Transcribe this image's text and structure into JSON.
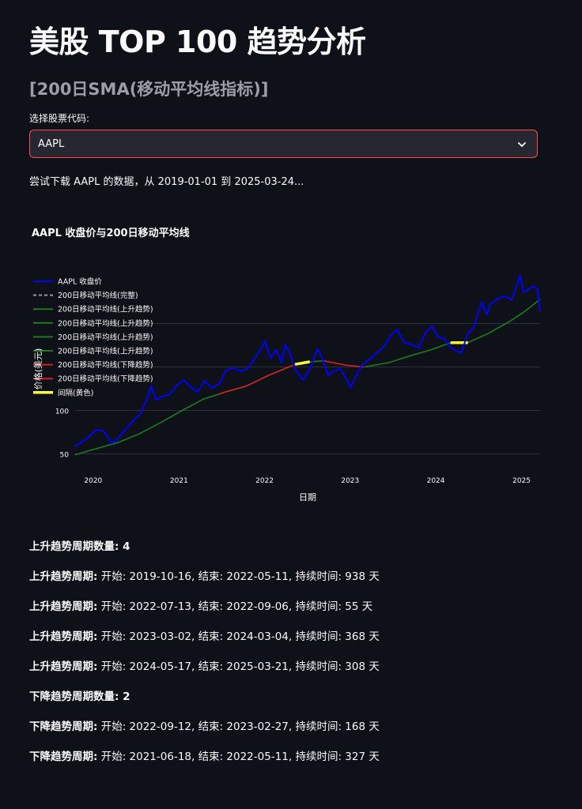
{
  "title": "美股 TOP 100 趋势分析",
  "subtitle": "[200日SMA(移动平均线指标)]",
  "selector": {
    "label": "选择股票代码:",
    "value": "AAPL"
  },
  "info": "尝试下载 AAPL 的数据，从 2019-01-01 到 2025-03-24...",
  "colors": {
    "accent": "#ff4b4b",
    "price": "#0000ff",
    "sma_up": "#1f7a1f",
    "sma_down": "#d62020",
    "gap": "#ffff33"
  },
  "chart_data": {
    "type": "line",
    "title": "AAPL 收盘价与200日移动平均线",
    "xlabel": "日期",
    "ylabel": "价格(美元)",
    "x_ticks": [
      "2020",
      "2021",
      "2022",
      "2023",
      "2024",
      "2025"
    ],
    "y_ticks": [
      "50",
      "100"
    ],
    "ylim": [
      45,
      255
    ],
    "grid": true,
    "legend_position": "top-left",
    "legend": [
      "AAPL 收盘价",
      "200日移动平均线(完整)",
      "200日移动平均线(上升趋势)",
      "200日移动平均线(上升趋势)",
      "200日移动平均线(上升趋势)",
      "200日移动平均线(上升趋势)",
      "200日移动平均线(下降趋势)",
      "200日移动平均线(下降趋势)",
      "间隔(黄色)"
    ],
    "series": [
      {
        "name": "AAPL 收盘价",
        "x": [
          "2019-10-16",
          "2019-11-15",
          "2019-12-15",
          "2020-01-15",
          "2020-02-15",
          "2020-03-20",
          "2020-04-20",
          "2020-05-20",
          "2020-06-20",
          "2020-07-20",
          "2020-08-20",
          "2020-09-05",
          "2020-09-25",
          "2020-10-20",
          "2020-11-20",
          "2020-12-20",
          "2021-01-20",
          "2021-02-20",
          "2021-03-20",
          "2021-04-20",
          "2021-05-20",
          "2021-06-20",
          "2021-07-20",
          "2021-08-20",
          "2021-09-20",
          "2021-10-20",
          "2021-11-20",
          "2021-12-20",
          "2022-01-03",
          "2022-01-27",
          "2022-02-20",
          "2022-03-15",
          "2022-03-30",
          "2022-04-20",
          "2022-05-11",
          "2022-06-15",
          "2022-07-13",
          "2022-08-15",
          "2022-09-06",
          "2022-09-30",
          "2022-10-20",
          "2022-11-20",
          "2022-12-20",
          "2023-01-03",
          "2023-01-20",
          "2023-02-20",
          "2023-03-20",
          "2023-04-20",
          "2023-05-20",
          "2023-06-20",
          "2023-07-20",
          "2023-08-20",
          "2023-09-20",
          "2023-10-20",
          "2023-11-20",
          "2023-12-15",
          "2024-01-10",
          "2024-02-10",
          "2024-03-04",
          "2024-04-19",
          "2024-05-17",
          "2024-06-10",
          "2024-07-15",
          "2024-08-05",
          "2024-08-20",
          "2024-09-20",
          "2024-10-20",
          "2024-11-20",
          "2024-12-26",
          "2025-01-10",
          "2025-02-20",
          "2025-03-10",
          "2025-03-21"
        ],
        "values": [
          59,
          64,
          70,
          78,
          76,
          62,
          69,
          79,
          88,
          96,
          115,
          128,
          112,
          116,
          118,
          128,
          135,
          127,
          121,
          134,
          126,
          130,
          146,
          149,
          145,
          148,
          160,
          172,
          180,
          160,
          170,
          155,
          176,
          165,
          147,
          135,
          148,
          171,
          159,
          140,
          145,
          148,
          134,
          126,
          137,
          152,
          158,
          165,
          172,
          185,
          193,
          178,
          176,
          172,
          190,
          197,
          185,
          182,
          172,
          166,
          189,
          195,
          225,
          210,
          222,
          228,
          232,
          227,
          255,
          236,
          243,
          240,
          214
        ]
      },
      {
        "name": "200日移动平均线",
        "x": [
          "2019-10-16",
          "2020-01-15",
          "2020-04-15",
          "2020-07-15",
          "2020-10-15",
          "2021-01-15",
          "2021-04-15",
          "2021-07-15",
          "2021-10-15",
          "2022-01-15",
          "2022-05-11",
          "2022-07-13",
          "2022-09-06",
          "2022-09-12",
          "2022-12-15",
          "2023-02-27",
          "2023-03-02",
          "2023-06-15",
          "2023-09-15",
          "2023-12-15",
          "2024-03-04",
          "2024-05-17",
          "2024-08-15",
          "2024-11-15",
          "2025-01-15",
          "2025-03-21"
        ],
        "values": [
          49,
          56,
          63,
          73,
          86,
          100,
          113,
          121,
          128,
          140,
          153,
          156,
          157,
          157,
          152,
          150,
          150,
          155,
          163,
          170,
          178,
          178,
          189,
          203,
          214,
          228
        ]
      }
    ],
    "trend_segments": [
      {
        "type": "上升",
        "start": "2019-10-16",
        "end": "2022-05-11"
      },
      {
        "type": "间隔",
        "start": "2022-05-11",
        "end": "2022-07-13"
      },
      {
        "type": "上升",
        "start": "2022-07-13",
        "end": "2022-09-06"
      },
      {
        "type": "下降",
        "start": "2021-06-18",
        "end": "2022-05-11"
      },
      {
        "type": "下降",
        "start": "2022-09-12",
        "end": "2023-02-27"
      },
      {
        "type": "上升",
        "start": "2023-03-02",
        "end": "2024-03-04"
      },
      {
        "type": "间隔",
        "start": "2024-03-04",
        "end": "2024-05-17"
      },
      {
        "type": "上升",
        "start": "2024-05-17",
        "end": "2025-03-21"
      }
    ]
  },
  "results": [
    {
      "label": "上升趋势周期数量: 4",
      "text": ""
    },
    {
      "label": "上升趋势周期:",
      "text": " 开始: 2019-10-16, 结束: 2022-05-11, 持续时间: 938 天"
    },
    {
      "label": "上升趋势周期:",
      "text": " 开始: 2022-07-13, 结束: 2022-09-06, 持续时间: 55 天"
    },
    {
      "label": "上升趋势周期:",
      "text": " 开始: 2023-03-02, 结束: 2024-03-04, 持续时间: 368 天"
    },
    {
      "label": "上升趋势周期:",
      "text": " 开始: 2024-05-17, 结束: 2025-03-21, 持续时间: 308 天"
    },
    {
      "label": "下降趋势周期数量: 2",
      "text": ""
    },
    {
      "label": "下降趋势周期:",
      "text": " 开始: 2022-09-12, 结束: 2023-02-27, 持续时间: 168 天"
    },
    {
      "label": "下降趋势周期:",
      "text": " 开始: 2021-06-18, 结束: 2022-05-11, 持续时间: 327 天"
    }
  ]
}
